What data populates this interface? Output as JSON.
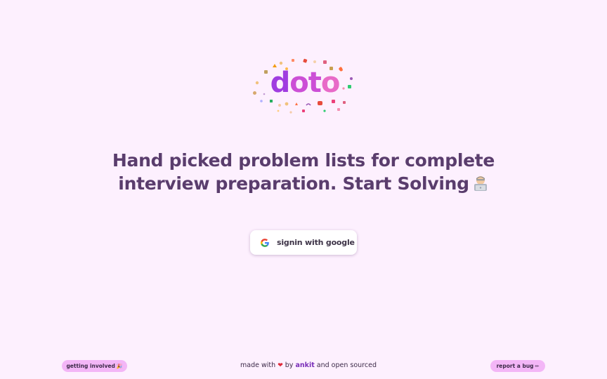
{
  "logo": {
    "part1": "d",
    "part2": "o",
    "part3": "t",
    "part4": "o",
    "cloud_icons": "decorative-sticker-icons"
  },
  "hero": {
    "line1": "Hand picked problem lists for complete",
    "line2": "interview preparation. Start Solving",
    "emoji_icon": "technologist-emoji-icon"
  },
  "signin": {
    "label": "signin with google",
    "icon": "google-icon"
  },
  "footer": {
    "left_pill": "getting involved",
    "left_pill_icon": "🎉",
    "made_with": "made with",
    "heart": "❤",
    "by": "by",
    "author": "ankit",
    "suffix": "and open sourced",
    "right_pill": "report a bug",
    "right_pill_icon": "✏"
  },
  "colors": {
    "background": "#fdf0fe",
    "headline": "#5a3d6d",
    "logo_start": "#a03ce0",
    "logo_end": "#e86ac8",
    "pill": "#f3b6f7",
    "author": "#7a2fb8"
  }
}
